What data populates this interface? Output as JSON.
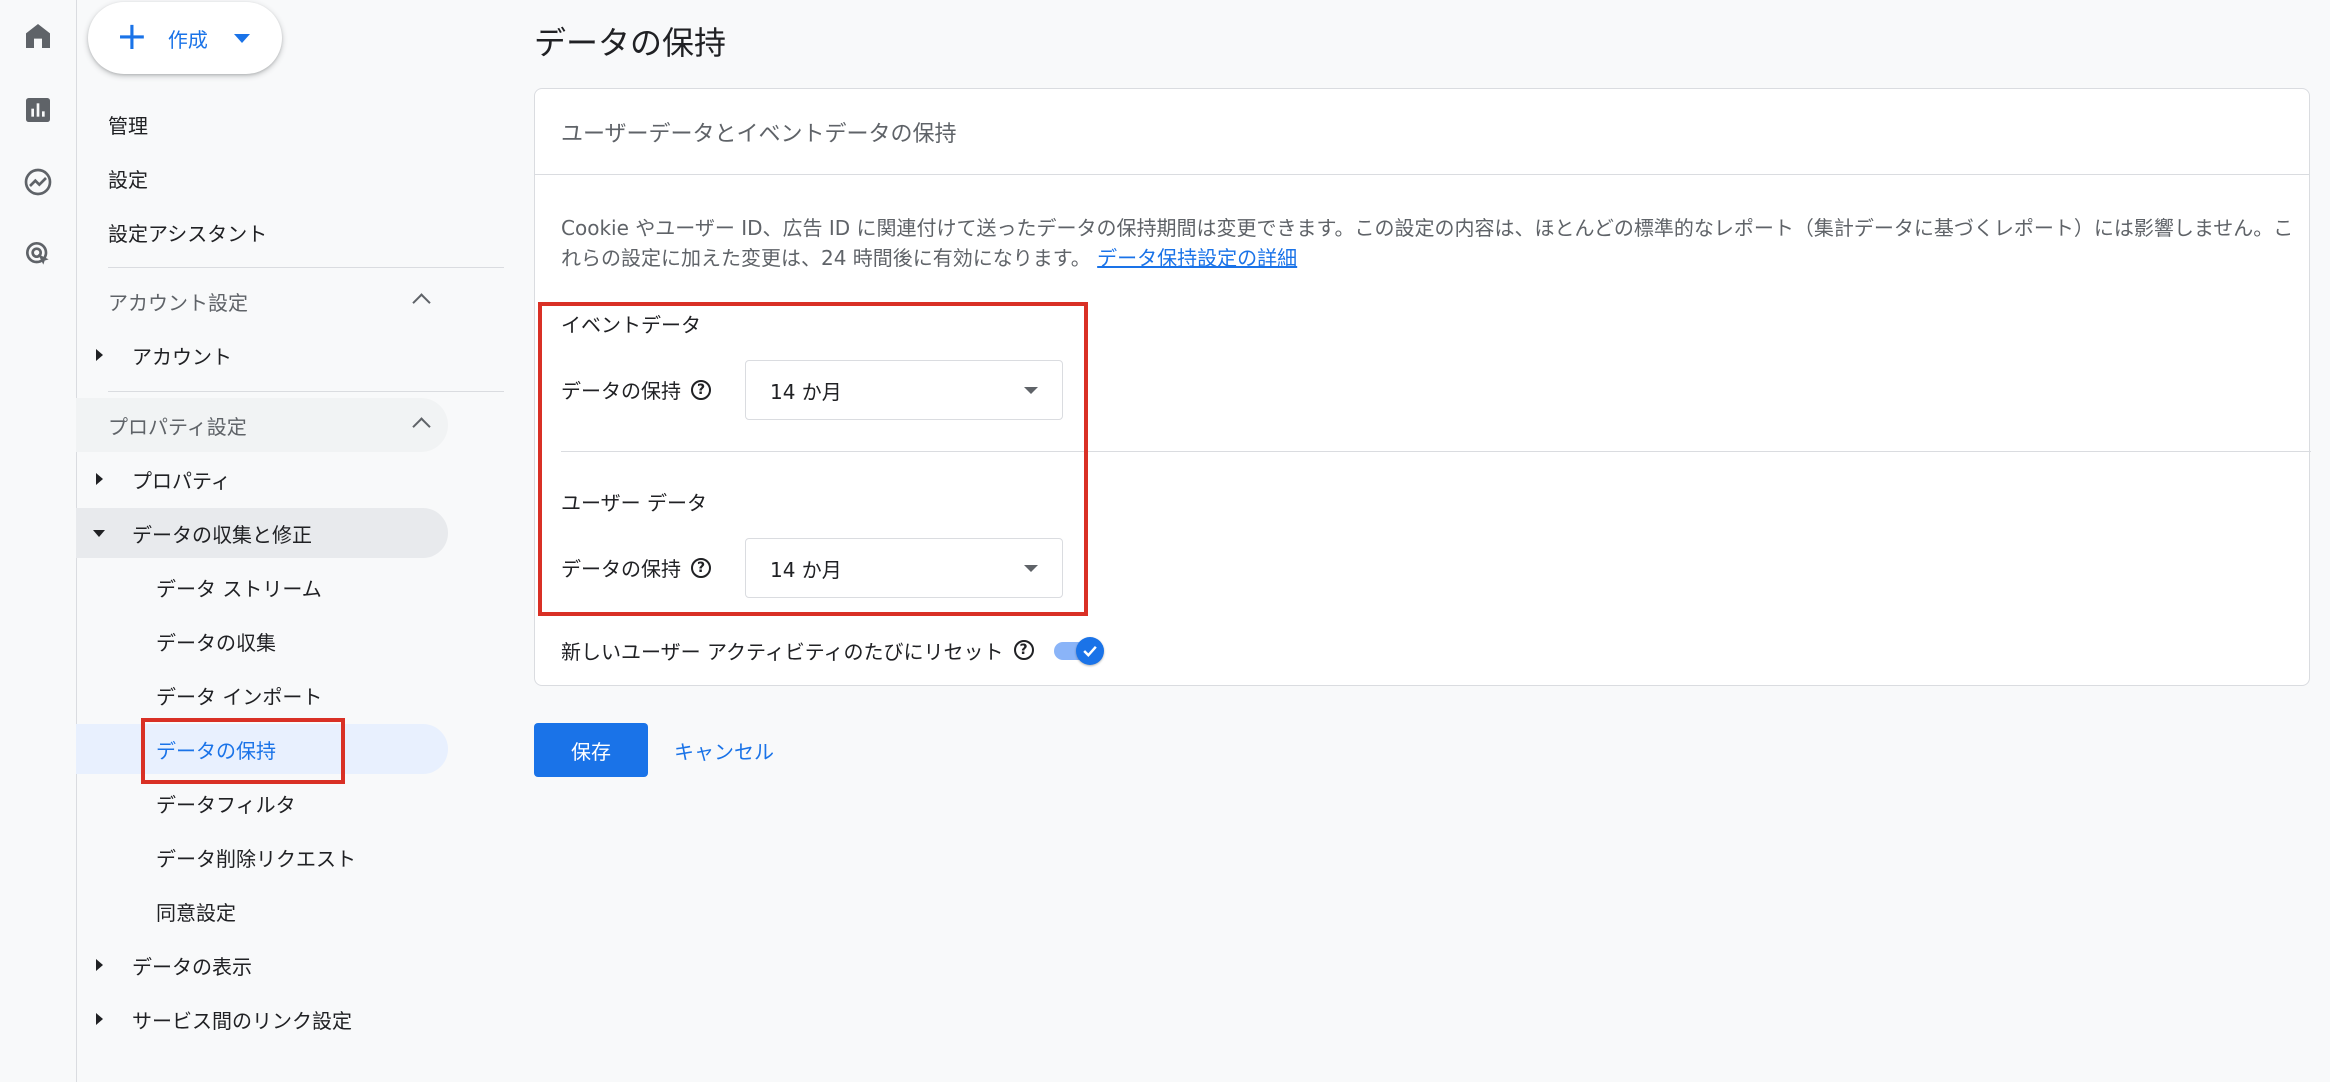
{
  "rail": {
    "icons": [
      "home-icon",
      "reports-icon",
      "explore-icon",
      "advertising-icon"
    ]
  },
  "create": {
    "label": "作成"
  },
  "nav": {
    "admin": "管理",
    "settings": "設定",
    "setup_assistant": "設定アシスタント",
    "account_section": "アカウント設定",
    "account": "アカウント",
    "property_section": "プロパティ設定",
    "property": "プロパティ",
    "data_collection_mod": "データの収集と修正",
    "data_streams": "データ ストリーム",
    "data_collection": "データの収集",
    "data_import": "データ インポート",
    "data_retention": "データの保持",
    "data_filters": "データフィルタ",
    "data_deletion": "データ削除リクエスト",
    "consent": "同意設定",
    "data_display": "データの表示",
    "product_links": "サービス間のリンク設定"
  },
  "main": {
    "title": "データの保持",
    "card_title": "ユーザーデータとイベントデータの保持",
    "description": "Cookie やユーザー ID、広告 ID に関連付けて送ったデータの保持期間は変更できます。この設定の内容は、ほとんどの標準的なレポート（集計データに基づくレポート）には影響しません。これらの設定に加えた変更は、24 時間後に有効になります。",
    "learn_more": "データ保持設定の詳細",
    "event": {
      "title": "イベントデータ",
      "label": "データの保持",
      "value": "14 か月"
    },
    "user": {
      "title": "ユーザー データ",
      "label": "データの保持",
      "value": "14 か月"
    },
    "reset_label": "新しいユーザー アクティビティのたびにリセット",
    "reset_on": true,
    "save": "保存",
    "cancel": "キャンセル"
  },
  "colors": {
    "accent": "#1a73e8",
    "highlight": "#d93025",
    "active_bg": "#e8f0fe"
  }
}
